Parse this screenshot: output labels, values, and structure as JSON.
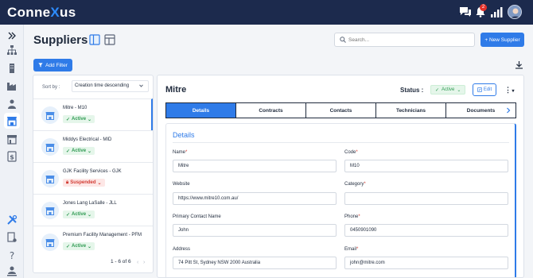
{
  "app": {
    "logo_part1": "Conne",
    "logo_x": "X",
    "logo_part2": "us",
    "notification_count": "2"
  },
  "page": {
    "title": "Suppliers",
    "search_placeholder": "Search...",
    "new_supplier_label": "+ New Supplier",
    "add_filter_label": "Add Filter"
  },
  "list": {
    "sort_label": "Sort by :",
    "sort_value": "Creation time descending",
    "pagination": "1 - 6 of 6",
    "items": [
      {
        "name": "Mitre - M10",
        "status": "Active",
        "status_kind": "active"
      },
      {
        "name": "Middys Electrical - MID",
        "status": "Active",
        "status_kind": "active"
      },
      {
        "name": "GJK Facility Services - GJK",
        "status": "Suspended",
        "status_kind": "suspended"
      },
      {
        "name": "Jones Lang LaSalle - JLL",
        "status": "Active",
        "status_kind": "active"
      },
      {
        "name": "Premium Facility Management - PFM",
        "status": "Active",
        "status_kind": "active"
      }
    ]
  },
  "detail": {
    "title": "Mitre",
    "status_label": "Status :",
    "status_value": "Active",
    "edit_label": "Edit",
    "tabs": [
      "Details",
      "Contracts",
      "Contacts",
      "Technicians",
      "Documents"
    ],
    "section_title": "Details",
    "fields": {
      "name_label": "Name",
      "name_value": "Mitre",
      "code_label": "Code",
      "code_value": "M10",
      "website_label": "Website",
      "website_value": "https://www.mitre10.com.au/",
      "category_label": "Category",
      "category_value": "",
      "primary_contact_label": "Primary Contact Name",
      "primary_contact_value": "John",
      "phone_label": "Phone",
      "phone_value": "0450901090",
      "address_label": "Address",
      "address_value": "74 Pitt St, Sydney NSW 2000 Australia",
      "email_label": "Email",
      "email_value": "john@mitre.com"
    }
  },
  "colors": {
    "brand_navy": "#1c2a4d",
    "accent_blue": "#2f7be8",
    "active_green": "#2f9a52",
    "suspended_red": "#d23b32"
  }
}
